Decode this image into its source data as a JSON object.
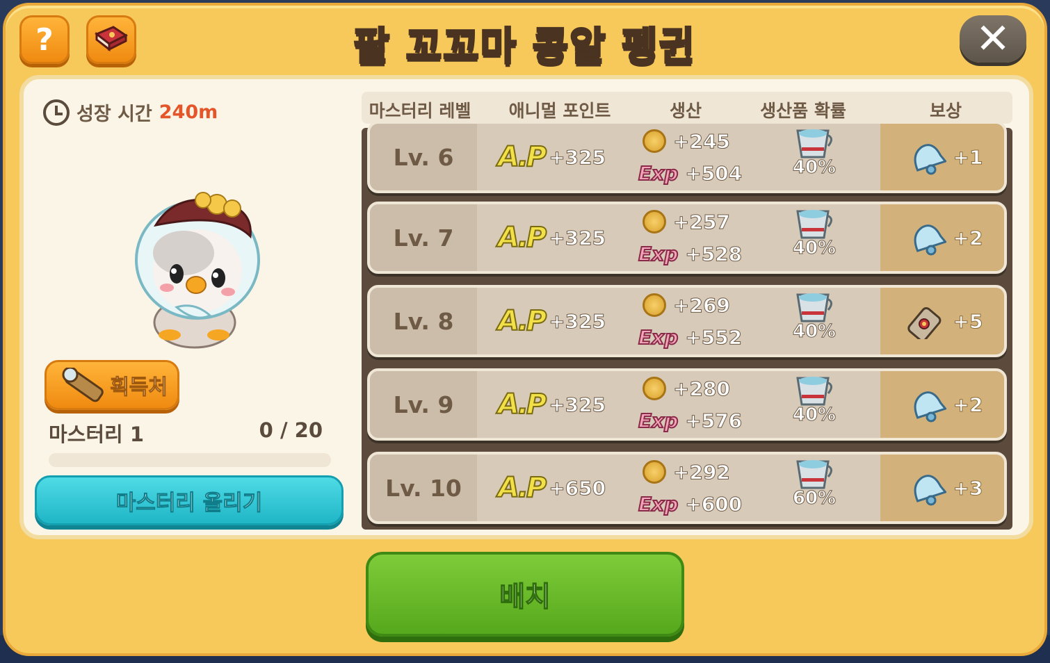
{
  "title": "팥 꼬꼬마 콩알 펭귄",
  "header": {
    "help_label": "?",
    "close_label": "✕"
  },
  "left": {
    "growth_label": "성장 시간",
    "growth_value": "240m",
    "source_button": "획득처",
    "mastery_label": "마스터리 1",
    "mastery_count": "0 / 20",
    "mastery_progress": 0,
    "mastery_up_button": "마스터리 올리기"
  },
  "table": {
    "headers": [
      "마스터리 레벨",
      "애니멀 포인트",
      "생산",
      "생산품 확률",
      "보상"
    ],
    "rows": [
      {
        "level": "Lv. 6",
        "ap_logo": "A.P",
        "ap": "+325",
        "coin": "+245",
        "exp_label": "Exp",
        "exp": "+504",
        "chance": "40%",
        "reward_icon": "bell-icon",
        "reward": "+1"
      },
      {
        "level": "Lv. 7",
        "ap_logo": "A.P",
        "ap": "+325",
        "coin": "+257",
        "exp_label": "Exp",
        "exp": "+528",
        "chance": "40%",
        "reward_icon": "bell-icon",
        "reward": "+2"
      },
      {
        "level": "Lv. 8",
        "ap_logo": "A.P",
        "ap": "+325",
        "coin": "+269",
        "exp_label": "Exp",
        "exp": "+552",
        "chance": "40%",
        "reward_icon": "can-icon",
        "reward": "+5"
      },
      {
        "level": "Lv. 9",
        "ap_logo": "A.P",
        "ap": "+325",
        "coin": "+280",
        "exp_label": "Exp",
        "exp": "+576",
        "chance": "40%",
        "reward_icon": "bell-icon",
        "reward": "+2"
      },
      {
        "level": "Lv. 10",
        "ap_logo": "A.P",
        "ap": "+650",
        "coin": "+292",
        "exp_label": "Exp",
        "exp": "+600",
        "chance": "60%",
        "reward_icon": "bell-icon",
        "reward": "+3"
      }
    ]
  },
  "deploy_button": "배치",
  "colors": {
    "panel": "#f7c85a",
    "accent_teal": "#1fb6c6",
    "accent_green": "#56a81c",
    "growth_value": "#e5552a"
  }
}
